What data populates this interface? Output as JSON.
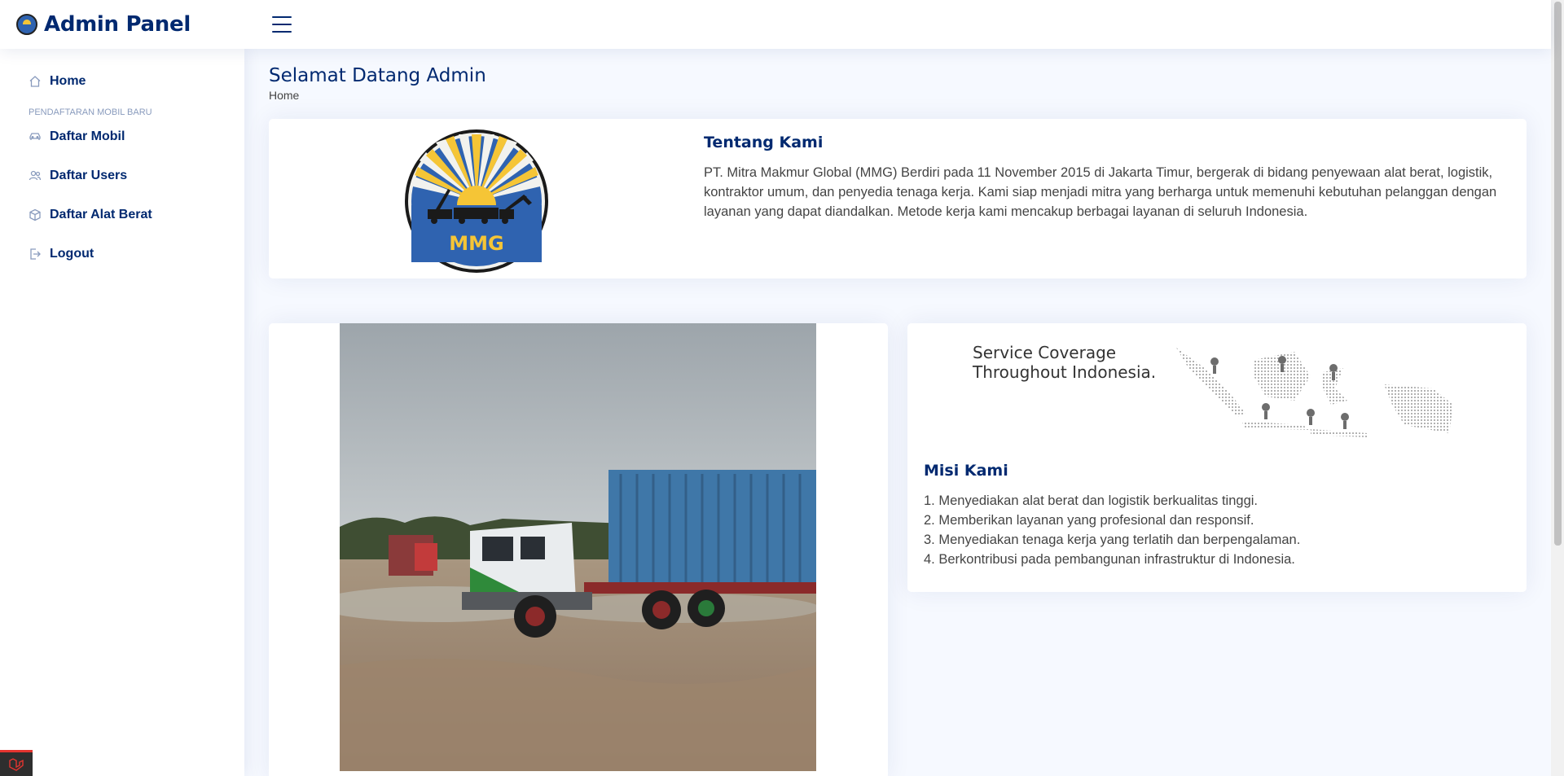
{
  "header": {
    "logo_text": "Admin Panel",
    "logo_icon": "mmg-logo-icon",
    "menu_icon": "hamburger-icon"
  },
  "sidebar": {
    "items": [
      {
        "label": "Home",
        "icon": "house-icon"
      },
      {
        "heading": "PENDAFTARAN MOBIL BARU"
      },
      {
        "label": "Daftar Mobil",
        "icon": "car-icon"
      },
      {
        "label": "Daftar Users",
        "icon": "users-icon"
      },
      {
        "label": "Daftar Alat Berat",
        "icon": "box-icon"
      },
      {
        "label": "Logout",
        "icon": "logout-icon"
      }
    ]
  },
  "page": {
    "title": "Selamat Datang Admin",
    "breadcrumb": "Home"
  },
  "about": {
    "title": "Tentang Kami",
    "body": "PT. Mitra Makmur Global (MMG) Berdiri pada 11 November 2015 di Jakarta Timur, bergerak di bidang penyewaan alat berat, logistik, kontraktor umum, dan penyedia tenaga kerja. Kami siap menjadi mitra yang berharga untuk memenuhi kebutuhan pelanggan dengan layanan yang dapat diandalkan. Metode kerja kami mencakup berbagai layanan di seluruh Indonesia.",
    "logo_text": "MMG"
  },
  "coverage": {
    "line1": "Service Coverage",
    "line2": "Throughout Indonesia."
  },
  "mission": {
    "title": "Misi Kami",
    "items": [
      "1. Menyediakan alat berat dan logistik berkualitas tinggi.",
      "2. Memberikan layanan yang profesional dan responsif.",
      "3. Menyediakan tenaga kerja yang terlatih dan berpengalaman.",
      "4. Berkontribusi pada pembangunan infrastruktur di Indonesia."
    ]
  },
  "colors": {
    "brand": "#012970",
    "accent_blue": "#2f63b0",
    "sun_yellow": "#f5c536",
    "muted": "#899bbd"
  }
}
